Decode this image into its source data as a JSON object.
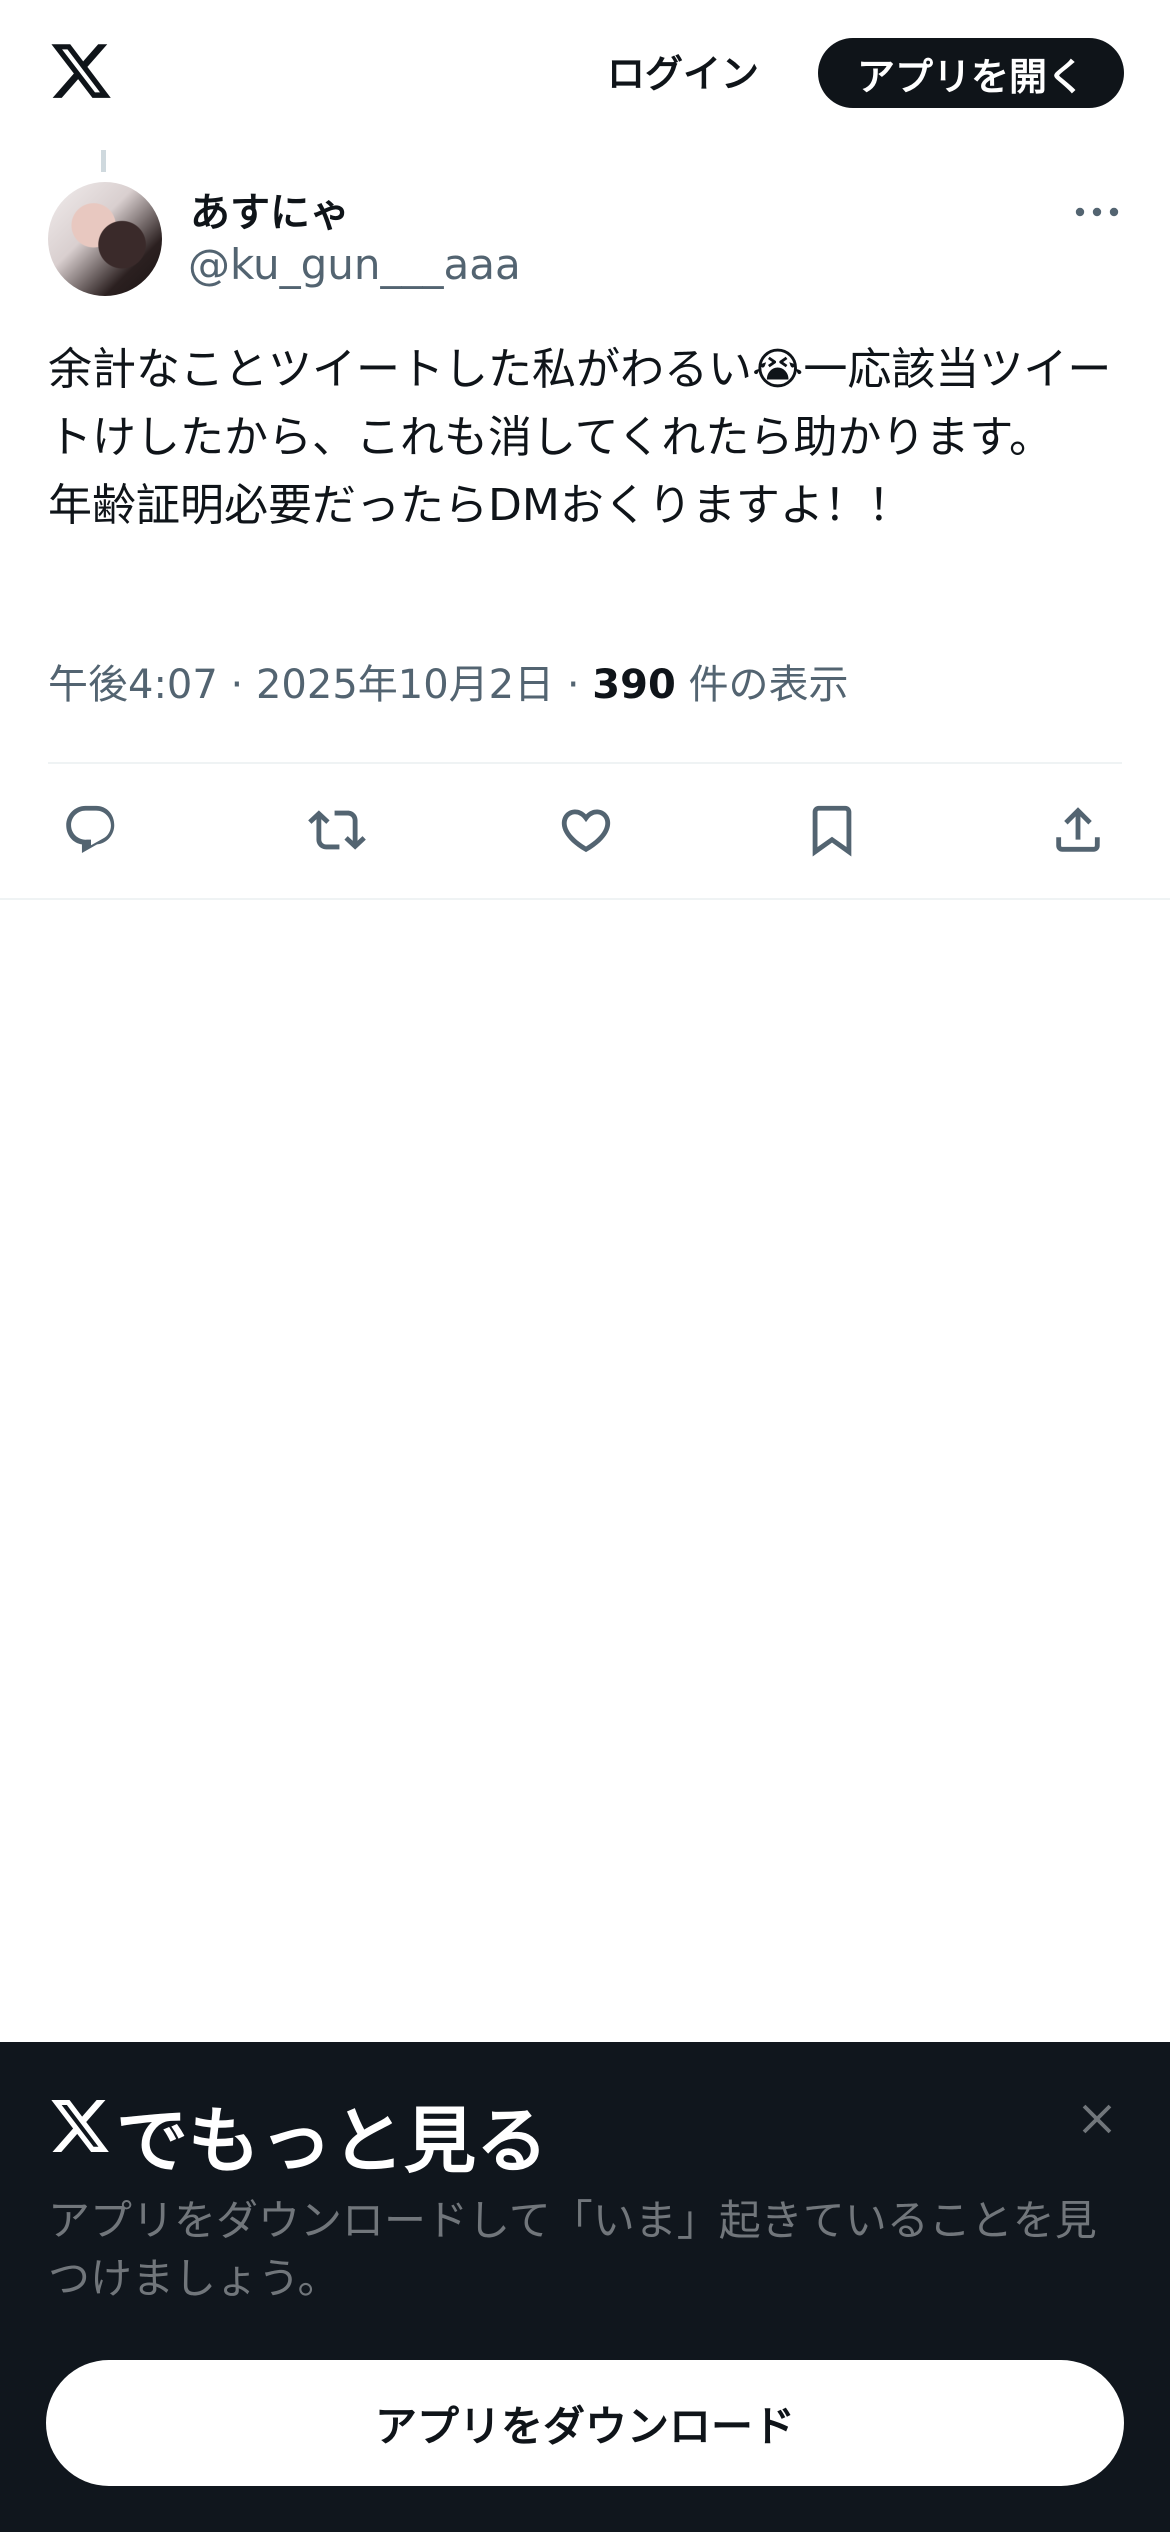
{
  "header": {
    "logo_icon": "x-logo-icon",
    "login_label": "ログイン",
    "open_app_label": "アプリを開く"
  },
  "tweet": {
    "display_name": "あすにゃ",
    "handle": "@ku_gun___aaa",
    "more_icon": "more-options-icon",
    "text": "余計なことツイートした私がわるい😭一応該当ツイートけしたから、これも消してくれたら助かります。\n年齢証明必要だったらDMおくりますよ！！",
    "time": "午後4:07",
    "separator": "·",
    "date": "2025年10月2日",
    "views_count": "390",
    "views_label": "件の表示"
  },
  "actions": [
    {
      "icon": "reply-icon"
    },
    {
      "icon": "retweet-icon"
    },
    {
      "icon": "like-icon"
    },
    {
      "icon": "bookmark-icon"
    },
    {
      "icon": "share-icon"
    }
  ],
  "promo": {
    "title": "でもっと見る",
    "subtitle": "アプリをダウンロードして「いま」起きていることを見つけましょう。",
    "download_label": "アプリをダウンロード",
    "close_icon": "close-icon"
  },
  "colors": {
    "text_primary": "#0f1419",
    "text_secondary": "#536471",
    "promo_bg": "#10161d",
    "promo_subtext": "#71767b",
    "divider": "#eff3f4"
  }
}
